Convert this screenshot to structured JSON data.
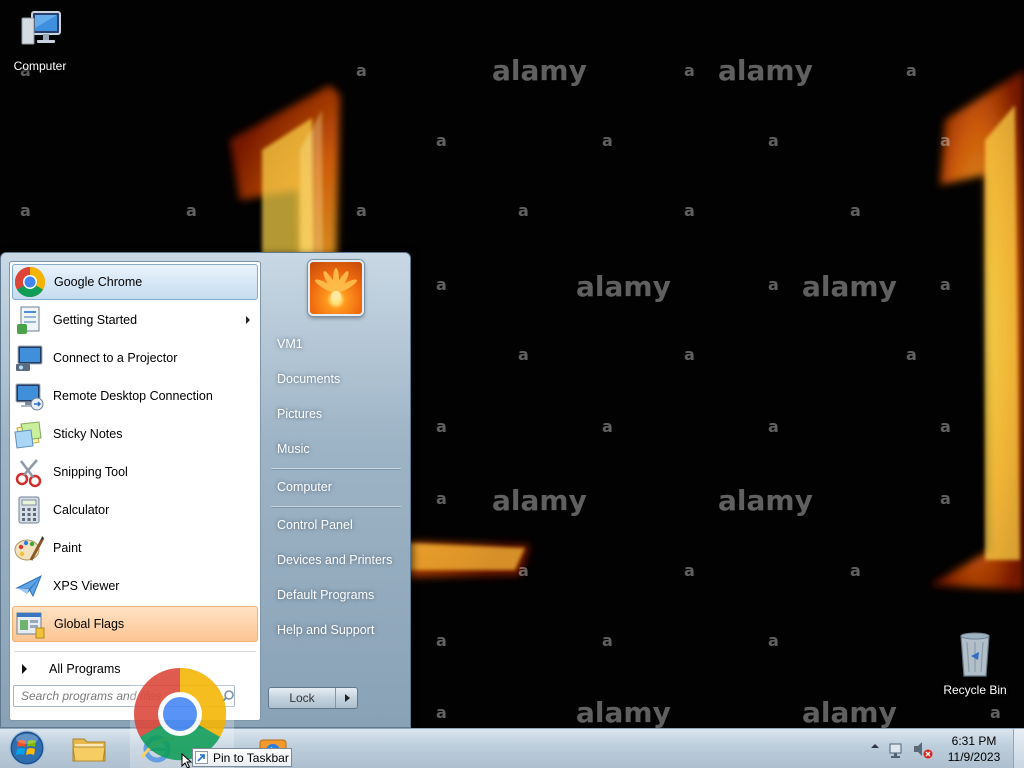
{
  "desktop": {
    "icons": [
      {
        "label": "Computer",
        "name": "computer-icon"
      },
      {
        "label": "Recycle Bin",
        "name": "recycle-bin-icon"
      }
    ],
    "watermark": {
      "logo": "alamy",
      "mark": "a"
    }
  },
  "start_menu": {
    "programs": [
      {
        "label": "Google Chrome",
        "icon": "chrome-icon",
        "state": "highlighted"
      },
      {
        "label": "Getting Started",
        "icon": "getting-started-icon",
        "has_submenu": true
      },
      {
        "label": "Connect to a Projector",
        "icon": "projector-icon"
      },
      {
        "label": "Remote Desktop Connection",
        "icon": "remote-desktop-icon"
      },
      {
        "label": "Sticky Notes",
        "icon": "sticky-notes-icon"
      },
      {
        "label": "Snipping Tool",
        "icon": "snipping-tool-icon"
      },
      {
        "label": "Calculator",
        "icon": "calculator-icon"
      },
      {
        "label": "Paint",
        "icon": "paint-icon"
      },
      {
        "label": "XPS Viewer",
        "icon": "xps-viewer-icon"
      },
      {
        "label": "Global Flags",
        "icon": "global-flags-icon",
        "state": "new"
      }
    ],
    "all_programs": "All Programs",
    "search": {
      "placeholder": "Search programs and files",
      "value": ""
    },
    "right_links": [
      {
        "label": "VM1",
        "name": "right-link-vm1"
      },
      {
        "label": "Documents",
        "name": "right-link-documents"
      },
      {
        "label": "Pictures",
        "name": "right-link-pictures"
      },
      {
        "label": "Music",
        "name": "right-link-music"
      },
      {
        "label": "Computer",
        "name": "right-link-computer"
      },
      {
        "label": "Control Panel",
        "name": "right-link-control-panel"
      },
      {
        "label": "Devices and Printers",
        "name": "right-link-devices-printers"
      },
      {
        "label": "Default Programs",
        "name": "right-link-default-programs"
      },
      {
        "label": "Help and Support",
        "name": "right-link-help-support"
      }
    ],
    "shutdown": {
      "label": "Lock"
    }
  },
  "taskbar": {
    "buttons": [
      {
        "name": "taskbar-explorer-button",
        "icon": "folder-icon"
      },
      {
        "name": "taskbar-ie-button",
        "icon": "ie-icon"
      },
      {
        "name": "taskbar-media-button",
        "icon": "media-player-icon"
      }
    ],
    "clock": {
      "time": "6:31 PM",
      "date": "11/9/2023"
    },
    "tray_icons": [
      "show-hidden-icons-icon",
      "network-icon",
      "volume-muted-icon"
    ]
  },
  "drag": {
    "tooltip": "Pin to Taskbar",
    "icon": "chrome-icon"
  },
  "colors": {
    "highlight_blue": "#c5dcf0",
    "new_program_orange": "#fcc593",
    "taskbar": "#bccddb"
  }
}
